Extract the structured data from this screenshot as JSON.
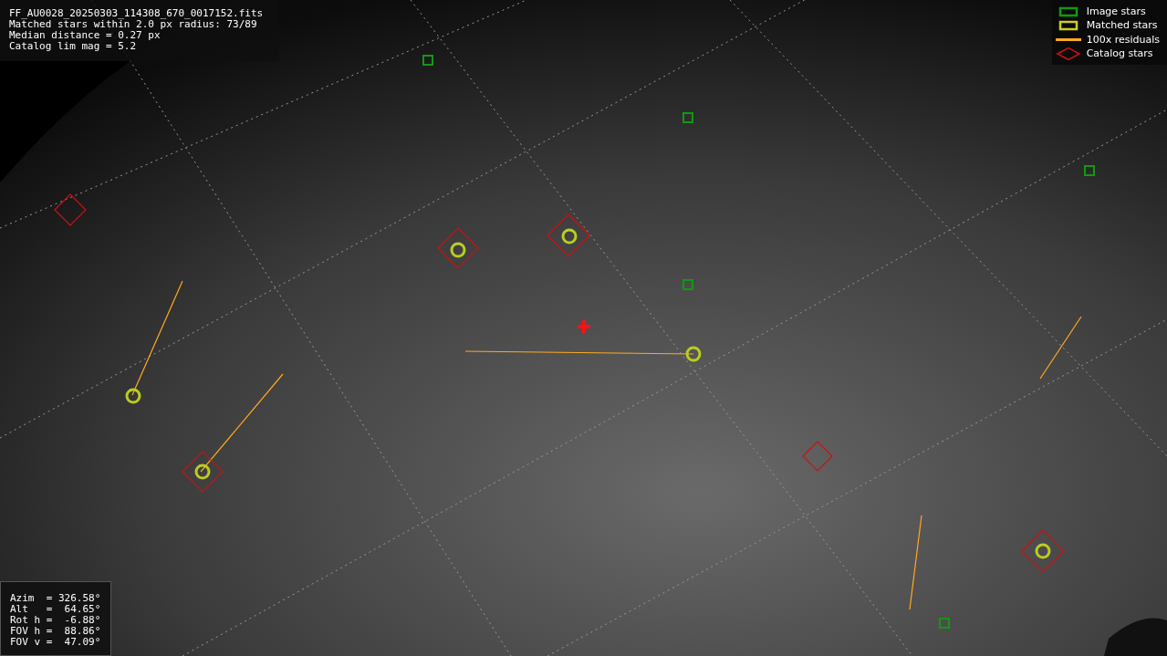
{
  "info": {
    "lines": [
      "FF_AU0028_20250303_114308_670_0017152.fits",
      "Matched stars within 2.0 px radius: 73/89",
      "Median distance = 0.27 px",
      "Catalog lim mag = 5.2"
    ]
  },
  "legend": [
    {
      "label": "Image stars",
      "kind": "box",
      "color": "#119911"
    },
    {
      "label": "Matched stars",
      "kind": "box",
      "color": "#cccc22"
    },
    {
      "label": "100x residuals",
      "kind": "line",
      "color": "#ffaa22"
    },
    {
      "label": "Catalog stars",
      "kind": "diamond",
      "color": "#cc1111"
    }
  ],
  "pointing": {
    "lines": [
      "Azim  = 326.58°",
      "Alt   =  64.65°",
      "Rot h =  -6.88°",
      "FOV h =  88.86°",
      "FOV v =  47.09°"
    ]
  }
}
